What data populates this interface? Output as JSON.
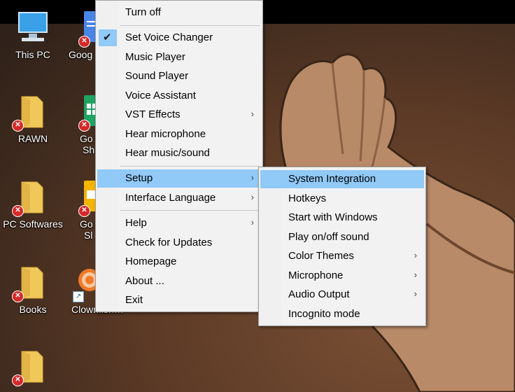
{
  "desktop": {
    "icons": [
      {
        "label": "This PC",
        "icon": "this-pc-icon"
      },
      {
        "label": "Goog",
        "icon": "google-docs-icon"
      },
      {
        "label": "RAWN",
        "icon": "folder-icon"
      },
      {
        "label": "Go",
        "icon": "google-sheets-icon"
      },
      {
        "label": "Sh",
        "icon": "google-sheets-icon"
      },
      {
        "label": "PC Softwares",
        "icon": "folder-icon"
      },
      {
        "label": "Go",
        "icon": "google-slides-icon"
      },
      {
        "label": "Sl",
        "icon": "google-slides-icon"
      },
      {
        "label": "Books",
        "icon": "folder-icon"
      },
      {
        "label": "Clownfish…",
        "icon": "clownfish-icon"
      }
    ]
  },
  "main_menu": {
    "items": [
      {
        "label": "Turn off"
      },
      {
        "label": "Set Voice Changer",
        "checked": true
      },
      {
        "label": "Music Player"
      },
      {
        "label": "Sound Player"
      },
      {
        "label": "Voice Assistant"
      },
      {
        "label": "VST Effects",
        "submenu": true
      },
      {
        "label": "Hear microphone"
      },
      {
        "label": "Hear music/sound"
      },
      {
        "label": "Setup",
        "submenu": true,
        "highlighted": true
      },
      {
        "label": "Interface Language",
        "submenu": true
      },
      {
        "label": "Help",
        "submenu": true
      },
      {
        "label": "Check for Updates"
      },
      {
        "label": "Homepage"
      },
      {
        "label": "About ..."
      },
      {
        "label": "Exit"
      }
    ]
  },
  "setup_submenu": {
    "items": [
      {
        "label": "System Integration",
        "highlighted": true
      },
      {
        "label": "Hotkeys"
      },
      {
        "label": "Start with Windows"
      },
      {
        "label": "Play on/off sound"
      },
      {
        "label": "Color Themes",
        "submenu": true
      },
      {
        "label": "Microphone",
        "submenu": true
      },
      {
        "label": "Audio Output",
        "submenu": true
      },
      {
        "label": "Incognito mode"
      }
    ]
  },
  "glyphs": {
    "arrow": "›",
    "check": "✔",
    "x": "✕",
    "shortcut": "↗"
  },
  "colors": {
    "highlight": "#91c9f7",
    "menu_bg": "#f2f2f2",
    "error_badge": "#d62828"
  }
}
